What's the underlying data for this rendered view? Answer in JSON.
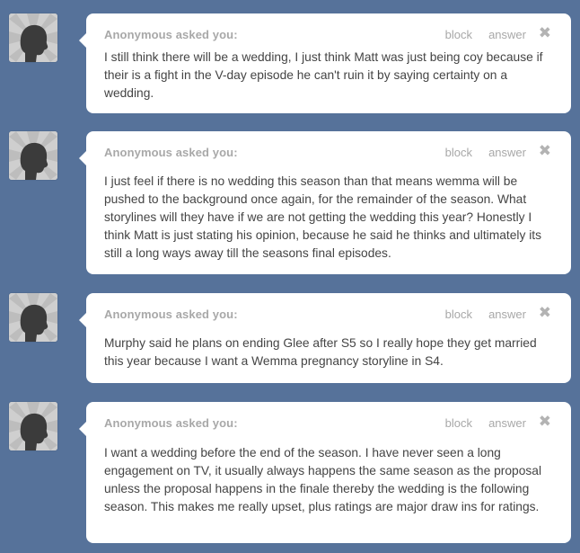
{
  "posts": [
    {
      "asker": "Anonymous asked you:",
      "block_label": "block",
      "answer_label": "answer",
      "close_glyph": "✖",
      "avatar_icon": "anonymous-avatar-icon",
      "question": "I still think there will be a wedding, I just think Matt was just being coy because if their is a fight in the V-day episode he can't ruin it by saying certainty on a wedding."
    },
    {
      "asker": "Anonymous asked you:",
      "block_label": "block",
      "answer_label": "answer",
      "close_glyph": "✖",
      "avatar_icon": "anonymous-avatar-icon",
      "question": "I just feel if there is no wedding this season than that means wemma will be pushed to the background once again, for the remainder of the season. What storylines will they have if we are not getting the wedding this year? Honestly I think Matt is just stating his opinion, because he said he thinks and ultimately its still a long ways away till the seasons final episodes."
    },
    {
      "asker": "Anonymous asked you:",
      "block_label": "block",
      "answer_label": "answer",
      "close_glyph": "✖",
      "avatar_icon": "anonymous-avatar-icon",
      "question": "Murphy said he plans on ending Glee after S5 so I really hope they get married this year because I want a Wemma pregnancy storyline in S4."
    },
    {
      "asker": "Anonymous asked you:",
      "block_label": "block",
      "answer_label": "answer",
      "close_glyph": "✖",
      "avatar_icon": "anonymous-avatar-icon",
      "question": "I want a wedding before the end of the season. I have never seen a long engagement on TV, it usually always happens the same season as the proposal unless the proposal happens in the finale thereby the wedding is the following season. This makes me really upset, plus ratings are major draw ins for ratings."
    }
  ],
  "colors": {
    "background": "#56729a",
    "card": "#ffffff",
    "meta_text": "#a8a8a8",
    "body_text": "#444444"
  }
}
